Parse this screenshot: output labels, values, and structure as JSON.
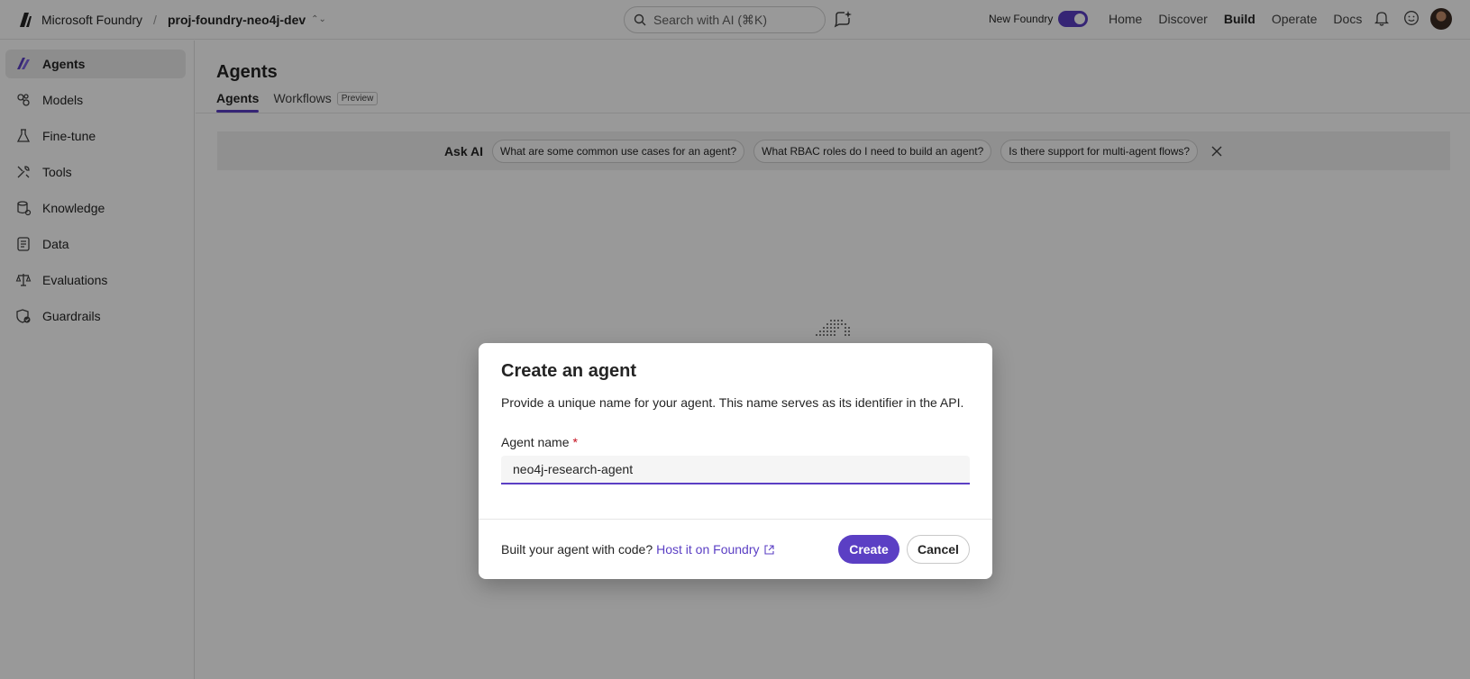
{
  "topbar": {
    "brand": "Microsoft Foundry",
    "separator": "/",
    "project": "proj-foundry-neo4j-dev",
    "search_placeholder": "Search with AI (⌘K)",
    "new_foundry_label": "New Foundry",
    "new_foundry_on": true,
    "nav": [
      {
        "label": "Home",
        "active": false
      },
      {
        "label": "Discover",
        "active": false
      },
      {
        "label": "Build",
        "active": true
      },
      {
        "label": "Operate",
        "active": false
      },
      {
        "label": "Docs",
        "active": false
      }
    ],
    "icons": [
      "copilot-chat-icon",
      "bell-icon",
      "smiley-feedback-icon",
      "avatar"
    ]
  },
  "sidebar": {
    "items": [
      {
        "label": "Agents",
        "icon": "agents-icon",
        "active": true
      },
      {
        "label": "Models",
        "icon": "models-icon",
        "active": false
      },
      {
        "label": "Fine-tune",
        "icon": "flask-icon",
        "active": false
      },
      {
        "label": "Tools",
        "icon": "tools-icon",
        "active": false
      },
      {
        "label": "Knowledge",
        "icon": "knowledge-icon",
        "active": false
      },
      {
        "label": "Data",
        "icon": "data-icon",
        "active": false
      },
      {
        "label": "Evaluations",
        "icon": "scales-icon",
        "active": false
      },
      {
        "label": "Guardrails",
        "icon": "shield-check-icon",
        "active": false
      }
    ]
  },
  "main": {
    "title": "Agents",
    "tabs": [
      {
        "label": "Agents",
        "active": true
      },
      {
        "label": "Workflows",
        "active": false,
        "badge": "Preview"
      }
    ],
    "ask_ai": {
      "label": "Ask AI",
      "chips": [
        "What are some common use cases for an agent?",
        "What RBAC roles do I need to build an agent?",
        "Is there support for multi-agent flows?"
      ]
    }
  },
  "dialog": {
    "title": "Create an agent",
    "description": "Provide a unique name for your agent. This name serves as its identifier in the API.",
    "field_label": "Agent name",
    "required_marker": "*",
    "field_value": "neo4j-research-agent",
    "footer_text": "Built your agent with code?",
    "footer_link": "Host it on Foundry",
    "create_label": "Create",
    "cancel_label": "Cancel"
  },
  "colors": {
    "accent": "#5b3fc4",
    "required": "#c50f1f"
  }
}
